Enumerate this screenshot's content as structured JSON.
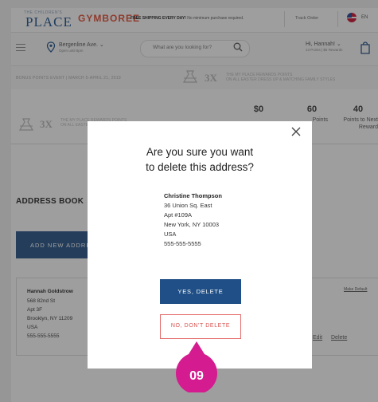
{
  "header": {
    "logo_sub": "THE CHILDREN'S",
    "logo": "PLACE",
    "brand2": "GYMBOREE",
    "shipping_bold": "FREE SHIPPING EVERY DAY!",
    "shipping_rest": " No minimum purchase required.",
    "track_order": "Track Order",
    "lang": "EN"
  },
  "subbar": {
    "store_name": "Bergenline Ave.",
    "store_hours": "Open until 8pm",
    "search_placeholder": "What are you looking for?",
    "greeting": "Hi, Hannah!",
    "points": "13 Points | $5 Rewards"
  },
  "promo": {
    "event": "BONUS POINTS EVENT  |  MARCH 5-APRIL 21, 2019",
    "multiplier": "3X",
    "line1": "THE MY PLACE REWARDS POINTS",
    "line2": "ON ALL EASTER DRESS UP & MATCHING FAMILY STYLES"
  },
  "page": {
    "banner_multiplier": "3X",
    "banner_line1": "THE MY PLACE REWARDS POINTS",
    "banner_line2": "ON ALL EASTER",
    "stats": [
      {
        "value": "$0",
        "label": ""
      },
      {
        "value": "60",
        "label": "Points"
      },
      {
        "value": "40",
        "label": "Points to Next Reward"
      }
    ],
    "address_book_title": "ADDRESS BOOK",
    "add_new_button": "ADD NEW ADDRESS",
    "card": {
      "name": "Hannah Goldstrow",
      "lines": [
        "568 82nd St",
        "Apt 3F",
        "Brooklyn, NY 11209",
        "USA",
        "555-555-5555"
      ],
      "make_default": "Make Default",
      "edit": "Edit",
      "delete": "Delete"
    }
  },
  "modal": {
    "question_line1": "Are you sure you want",
    "question_line2": "to delete this address?",
    "address": {
      "name": "Christine Thompson",
      "lines": [
        "36 Union Sq. East",
        "Apt #109A",
        "New York, NY 10003",
        "USA",
        "555-555-5555"
      ]
    },
    "confirm_button": "YES, DELETE",
    "cancel_button": "NO, DON'T DELETE"
  },
  "step_badge": "09",
  "colors": {
    "brand_blue": "#1f4f86",
    "cancel_red": "#d9534f",
    "badge_magenta": "#d41b8f"
  }
}
